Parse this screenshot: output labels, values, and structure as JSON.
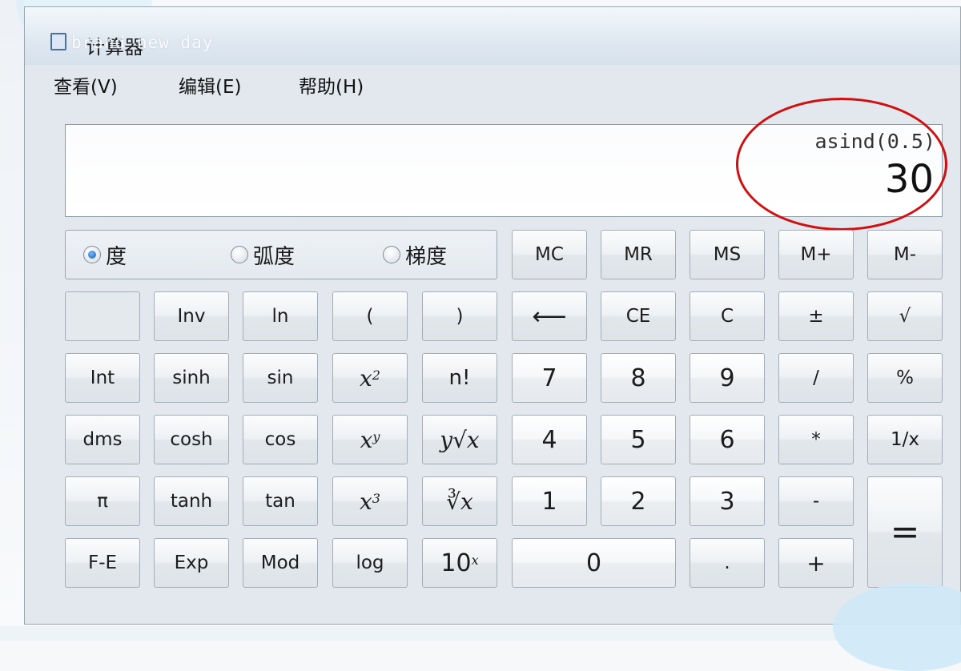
{
  "window": {
    "title": "计算器",
    "watermark": "brand new day"
  },
  "menu": [
    {
      "id": "view",
      "label": "查看(V)"
    },
    {
      "id": "edit",
      "label": "编辑(E)"
    },
    {
      "id": "help",
      "label": "帮助(H)"
    }
  ],
  "display": {
    "expression": "asind(0.5)",
    "result": "30"
  },
  "angle_modes": [
    {
      "id": "degrees",
      "label": "度",
      "selected": true
    },
    {
      "id": "radians",
      "label": "弧度",
      "selected": false
    },
    {
      "id": "grads",
      "label": "梯度",
      "selected": false
    }
  ],
  "buttons": {
    "mc": "MC",
    "mr": "MR",
    "ms": "MS",
    "mplus": "M+",
    "mminus": "M-",
    "inv": "Inv",
    "ln": "ln",
    "lparen": "(",
    "rparen": ")",
    "backspace": "⟵",
    "ce": "CE",
    "c": "C",
    "negate": "±",
    "sqrt": "√",
    "int": "Int",
    "sinh": "sinh",
    "sin": "sin",
    "square": "x",
    "square_exp": "2",
    "factorial": "n!",
    "seven": "7",
    "eight": "8",
    "nine": "9",
    "divide": "/",
    "percent": "%",
    "dms": "dms",
    "cosh": "cosh",
    "cos": "cos",
    "power": "x",
    "power_exp": "y",
    "yroot": "∛x",
    "yroot_text": "y√x",
    "four": "4",
    "five": "5",
    "six": "6",
    "multiply": "*",
    "reciprocal": "1/x",
    "pi": "π",
    "tanh": "tanh",
    "tan": "tan",
    "cube": "x",
    "cube_exp": "3",
    "cuberoot": "∛x",
    "one": "1",
    "two": "2",
    "three": "3",
    "subtract": "-",
    "equals": "=",
    "fe": "F-E",
    "exp": "Exp",
    "mod": "Mod",
    "log": "log",
    "tenpow": "10",
    "tenpow_exp": "x",
    "zero": "0",
    "decimal": ".",
    "add": "+"
  }
}
